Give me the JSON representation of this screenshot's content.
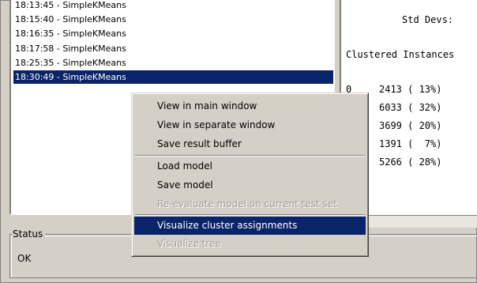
{
  "result_list": {
    "items": [
      "18:13:45 - SimpleKMeans",
      "18:15:40 - SimpleKMeans",
      "18:16:35 - SimpleKMeans",
      "18:17:58 - SimpleKMeans",
      "18:25:35 - SimpleKMeans",
      "18:30:49 - SimpleKMeans"
    ],
    "selected_index": 5
  },
  "output": {
    "std_devs": "Std Devs:",
    "clustered_instances": "Clustered Instances",
    "rows": [
      {
        "cluster": "0",
        "count": "2413 ( 13%)"
      },
      {
        "cluster": "",
        "count": "6033 ( 32%)"
      },
      {
        "cluster": "",
        "count": "3699 ( 20%)"
      },
      {
        "cluster": "",
        "count": "1391 (  7%)"
      },
      {
        "cluster": "",
        "count": "5266 ( 28%)"
      }
    ]
  },
  "context_menu": {
    "items": [
      {
        "label": "View in main window",
        "enabled": true
      },
      {
        "label": "View in separate window",
        "enabled": true
      },
      {
        "label": "Save result buffer",
        "enabled": true
      },
      {
        "label": "Load model",
        "enabled": true
      },
      {
        "label": "Save model",
        "enabled": true
      },
      {
        "label": "Re-evaluate model on current test set",
        "enabled": false
      },
      {
        "label": "Visualize cluster assignments",
        "enabled": true,
        "highlighted": true
      },
      {
        "label": "Visualize tree",
        "enabled": false
      }
    ]
  },
  "status": {
    "legend": "Status",
    "text": "OK"
  },
  "colors": {
    "selection": "#0a246a",
    "panel_bg": "#d4d0c8"
  }
}
